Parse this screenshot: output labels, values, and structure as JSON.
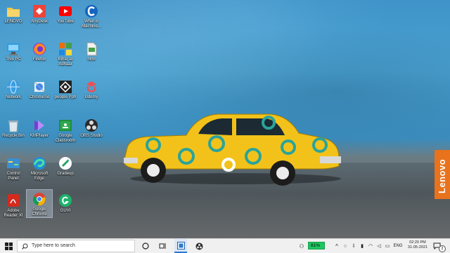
{
  "desktop": {
    "brand_label": "Lenovo",
    "icons": [
      {
        "label": "LENOVO",
        "icon": "folder-icon"
      },
      {
        "label": "AnyDesk",
        "icon": "anydesk-icon"
      },
      {
        "label": "YouTube",
        "icon": "youtube-icon"
      },
      {
        "label": "What is Machine...",
        "icon": "c-app-icon"
      },
      {
        "label": "This PC",
        "icon": "this-pc-icon"
      },
      {
        "label": "Firefox",
        "icon": "firefox-icon"
      },
      {
        "label": "Bihar at Adhaar",
        "icon": "bihar-app-icon"
      },
      {
        "label": "html",
        "icon": "html-file-icon"
      },
      {
        "label": "Network",
        "icon": "network-icon"
      },
      {
        "label": "ChromeSe",
        "icon": "chrome-setup-icon"
      },
      {
        "label": "people Pph",
        "icon": "people-app-icon"
      },
      {
        "label": "Udemy",
        "icon": "udemy-icon"
      },
      {
        "label": "Recycle Bin",
        "icon": "recycle-bin-icon"
      },
      {
        "label": "KMPlayer",
        "icon": "kmplayer-icon"
      },
      {
        "label": "Google Classroom",
        "icon": "google-classroom-icon"
      },
      {
        "label": "OBS Studio",
        "icon": "obs-studio-icon"
      },
      {
        "label": "Control Panel",
        "icon": "control-panel-icon"
      },
      {
        "label": "Microsoft Edge",
        "icon": "edge-icon"
      },
      {
        "label": "Gradeup",
        "icon": "gradeup-icon"
      },
      {
        "label": "Adobe Reader XI",
        "icon": "adobe-reader-icon"
      },
      {
        "label": "Google Chrome",
        "icon": "chrome-icon"
      },
      {
        "label": "GUVI",
        "icon": "guvi-icon"
      }
    ]
  },
  "taskbar": {
    "search_placeholder": "Type here to search",
    "battery_percent": "81%",
    "language": "ENG",
    "time": "02:20 PM",
    "date": "31-05-2021",
    "notification_count": "2"
  },
  "colors": {
    "wall": "#3f93c8",
    "car_yellow": "#f2c21a",
    "car_dots": "#2aa39b",
    "brand_orange": "#e8731c",
    "taskbar": "#f0f0f0"
  }
}
